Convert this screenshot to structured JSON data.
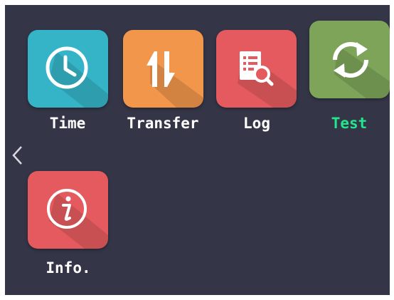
{
  "menu": {
    "items": [
      {
        "label": "Time",
        "icon": "clock-icon",
        "color": "#35b4c8",
        "active": false
      },
      {
        "label": "Transfer",
        "icon": "transfer-arrows-icon",
        "color": "#f1964a",
        "active": false
      },
      {
        "label": "Log",
        "icon": "log-search-icon",
        "color": "#e45a5e",
        "active": false
      },
      {
        "label": "Test",
        "icon": "refresh-icon",
        "color": "#7ea45a",
        "active": true
      },
      {
        "label": "Info.",
        "icon": "info-icon",
        "color": "#e45a5e",
        "active": false
      }
    ],
    "back_icon": "chevron-left-icon"
  },
  "colors": {
    "background": "#343648",
    "active_label": "#22e58c",
    "label": "#ffffff"
  }
}
